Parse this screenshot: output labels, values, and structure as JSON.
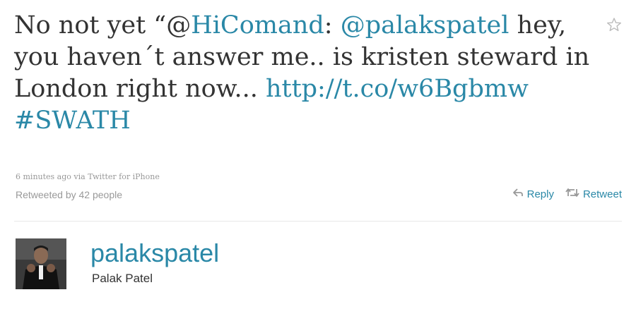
{
  "tweet": {
    "text_prefix": "No not yet “@",
    "mention1": "HiComand",
    "text_colon": ": ",
    "mention2": "@palakspatel",
    "text_body": " hey, you haven´t answer me.. is kristen steward in London right now... ",
    "link": "http://t.co/w6Bgbmw",
    "hashtag": "#SWATH",
    "meta": "6 minutes ago via Twitter for iPhone",
    "retweeted_by": "Retweeted by 42 people",
    "favorite_icon": "star-outline-icon"
  },
  "actions": {
    "reply_label": "Reply",
    "reply_icon": "reply-arrow-icon",
    "retweet_label": "Retweet",
    "retweet_icon": "retweet-arrows-icon"
  },
  "author": {
    "handle": "palakspatel",
    "name": "Palak Patel"
  },
  "colors": {
    "link": "#2a88a7",
    "text": "#333333",
    "muted": "#999999"
  }
}
